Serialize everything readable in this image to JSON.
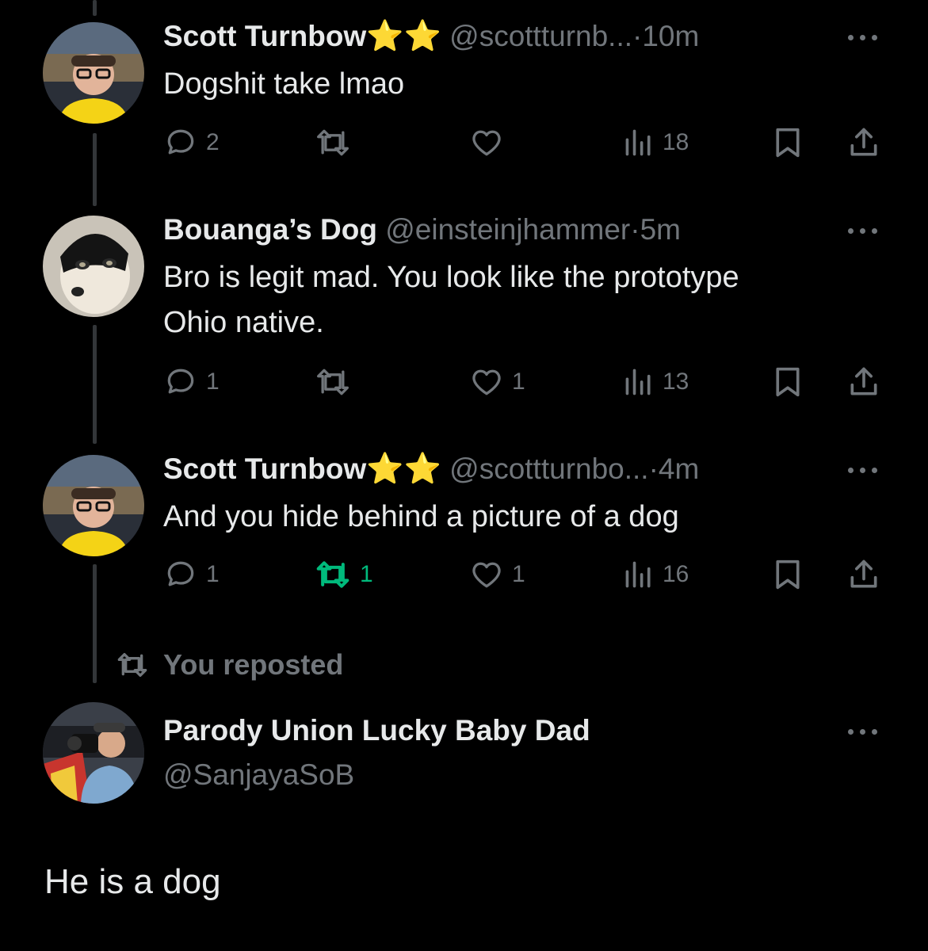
{
  "tweets": [
    {
      "name": "Scott Turnbow",
      "stars": "⭐⭐",
      "handle": "@scottturnb...",
      "dot": "·",
      "time": "10m",
      "text": "Dogshit take lmao",
      "replies": "2",
      "reposts": "",
      "likes": "",
      "views": "18"
    },
    {
      "name": "Bouanga’s Dog",
      "handle": "@einsteinjhammer",
      "dot": "·",
      "time": "5m",
      "text_line1": "Bro is legit mad. You look like the prototype",
      "text_line2": "Ohio native.",
      "replies": "1",
      "reposts": "",
      "likes": "1",
      "views": "13"
    },
    {
      "name": "Scott Turnbow",
      "stars": "⭐⭐",
      "handle": "@scottturnbo...",
      "dot": "·",
      "time": "4m",
      "text": "And you hide behind a picture of a dog",
      "replies": "1",
      "reposts": "1",
      "likes": "1",
      "views": "16"
    }
  ],
  "repost_label": "You reposted",
  "reposted": {
    "name": "Parody Union Lucky Baby Dad",
    "handle": "@SanjayaSoB",
    "text": "He is a dog"
  },
  "colors": {
    "background": "#000000",
    "text": "#e7e9ea",
    "muted": "#71767b",
    "repost_active": "#00ba7c",
    "star": "#ffc72c"
  }
}
